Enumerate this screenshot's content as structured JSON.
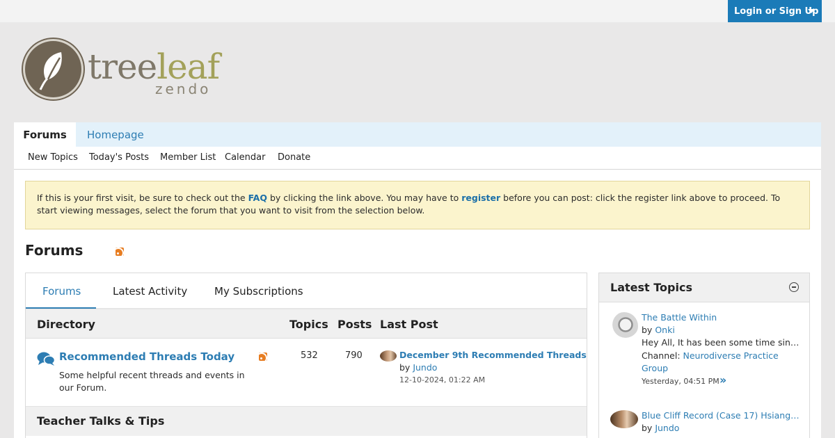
{
  "header": {
    "login_label": "Login or Sign Up",
    "logo": {
      "word_part1": "tree",
      "word_part2": "leaf",
      "sub": "zendo"
    }
  },
  "nav": {
    "tabs": [
      {
        "label": "Forums",
        "active": true
      },
      {
        "label": "Homepage",
        "active": false
      }
    ],
    "subnav": [
      "New Topics",
      "Today's Posts",
      "Member List",
      "Calendar",
      "Donate"
    ]
  },
  "notice": {
    "part1": "If this is your first visit, be sure to check out the ",
    "faq": "FAQ",
    "part2": " by clicking the link above. You may have to ",
    "register": "register",
    "part3": " before you can post: click the register link above to proceed. To start viewing messages, select the forum that you want to visit from the selection below."
  },
  "page": {
    "title": "Forums"
  },
  "forum_tabs": [
    "Forums",
    "Latest Activity",
    "My Subscriptions"
  ],
  "directory": {
    "columns": {
      "name": "Directory",
      "topics": "Topics",
      "posts": "Posts",
      "last_post": "Last Post"
    },
    "forums": [
      {
        "title": "Recommended Threads Today",
        "description": "Some helpful recent threads and events in our Forum.",
        "topics": "532",
        "posts": "790",
        "last_post": {
          "title": "December 9th Recommended Threads",
          "by_prefix": "by ",
          "user": "Jundo",
          "date": "12-10-2024, 01:22 AM"
        }
      }
    ],
    "next_section": "Teacher Talks & Tips"
  },
  "sidebar": {
    "title": "Latest Topics",
    "topics": [
      {
        "title": "The Battle Within",
        "by_prefix": "by ",
        "user": "Onki",
        "excerpt": "Hey All, It has been some time since...",
        "channel_prefix": "Channel: ",
        "channel": "Neurodiverse Practice Group",
        "date": "Yesterday, 04:51 PM"
      },
      {
        "title": "Blue Cliff Record (Case 17) Hsiang Li...",
        "by_prefix": "by ",
        "user": "Jundo"
      }
    ]
  }
}
